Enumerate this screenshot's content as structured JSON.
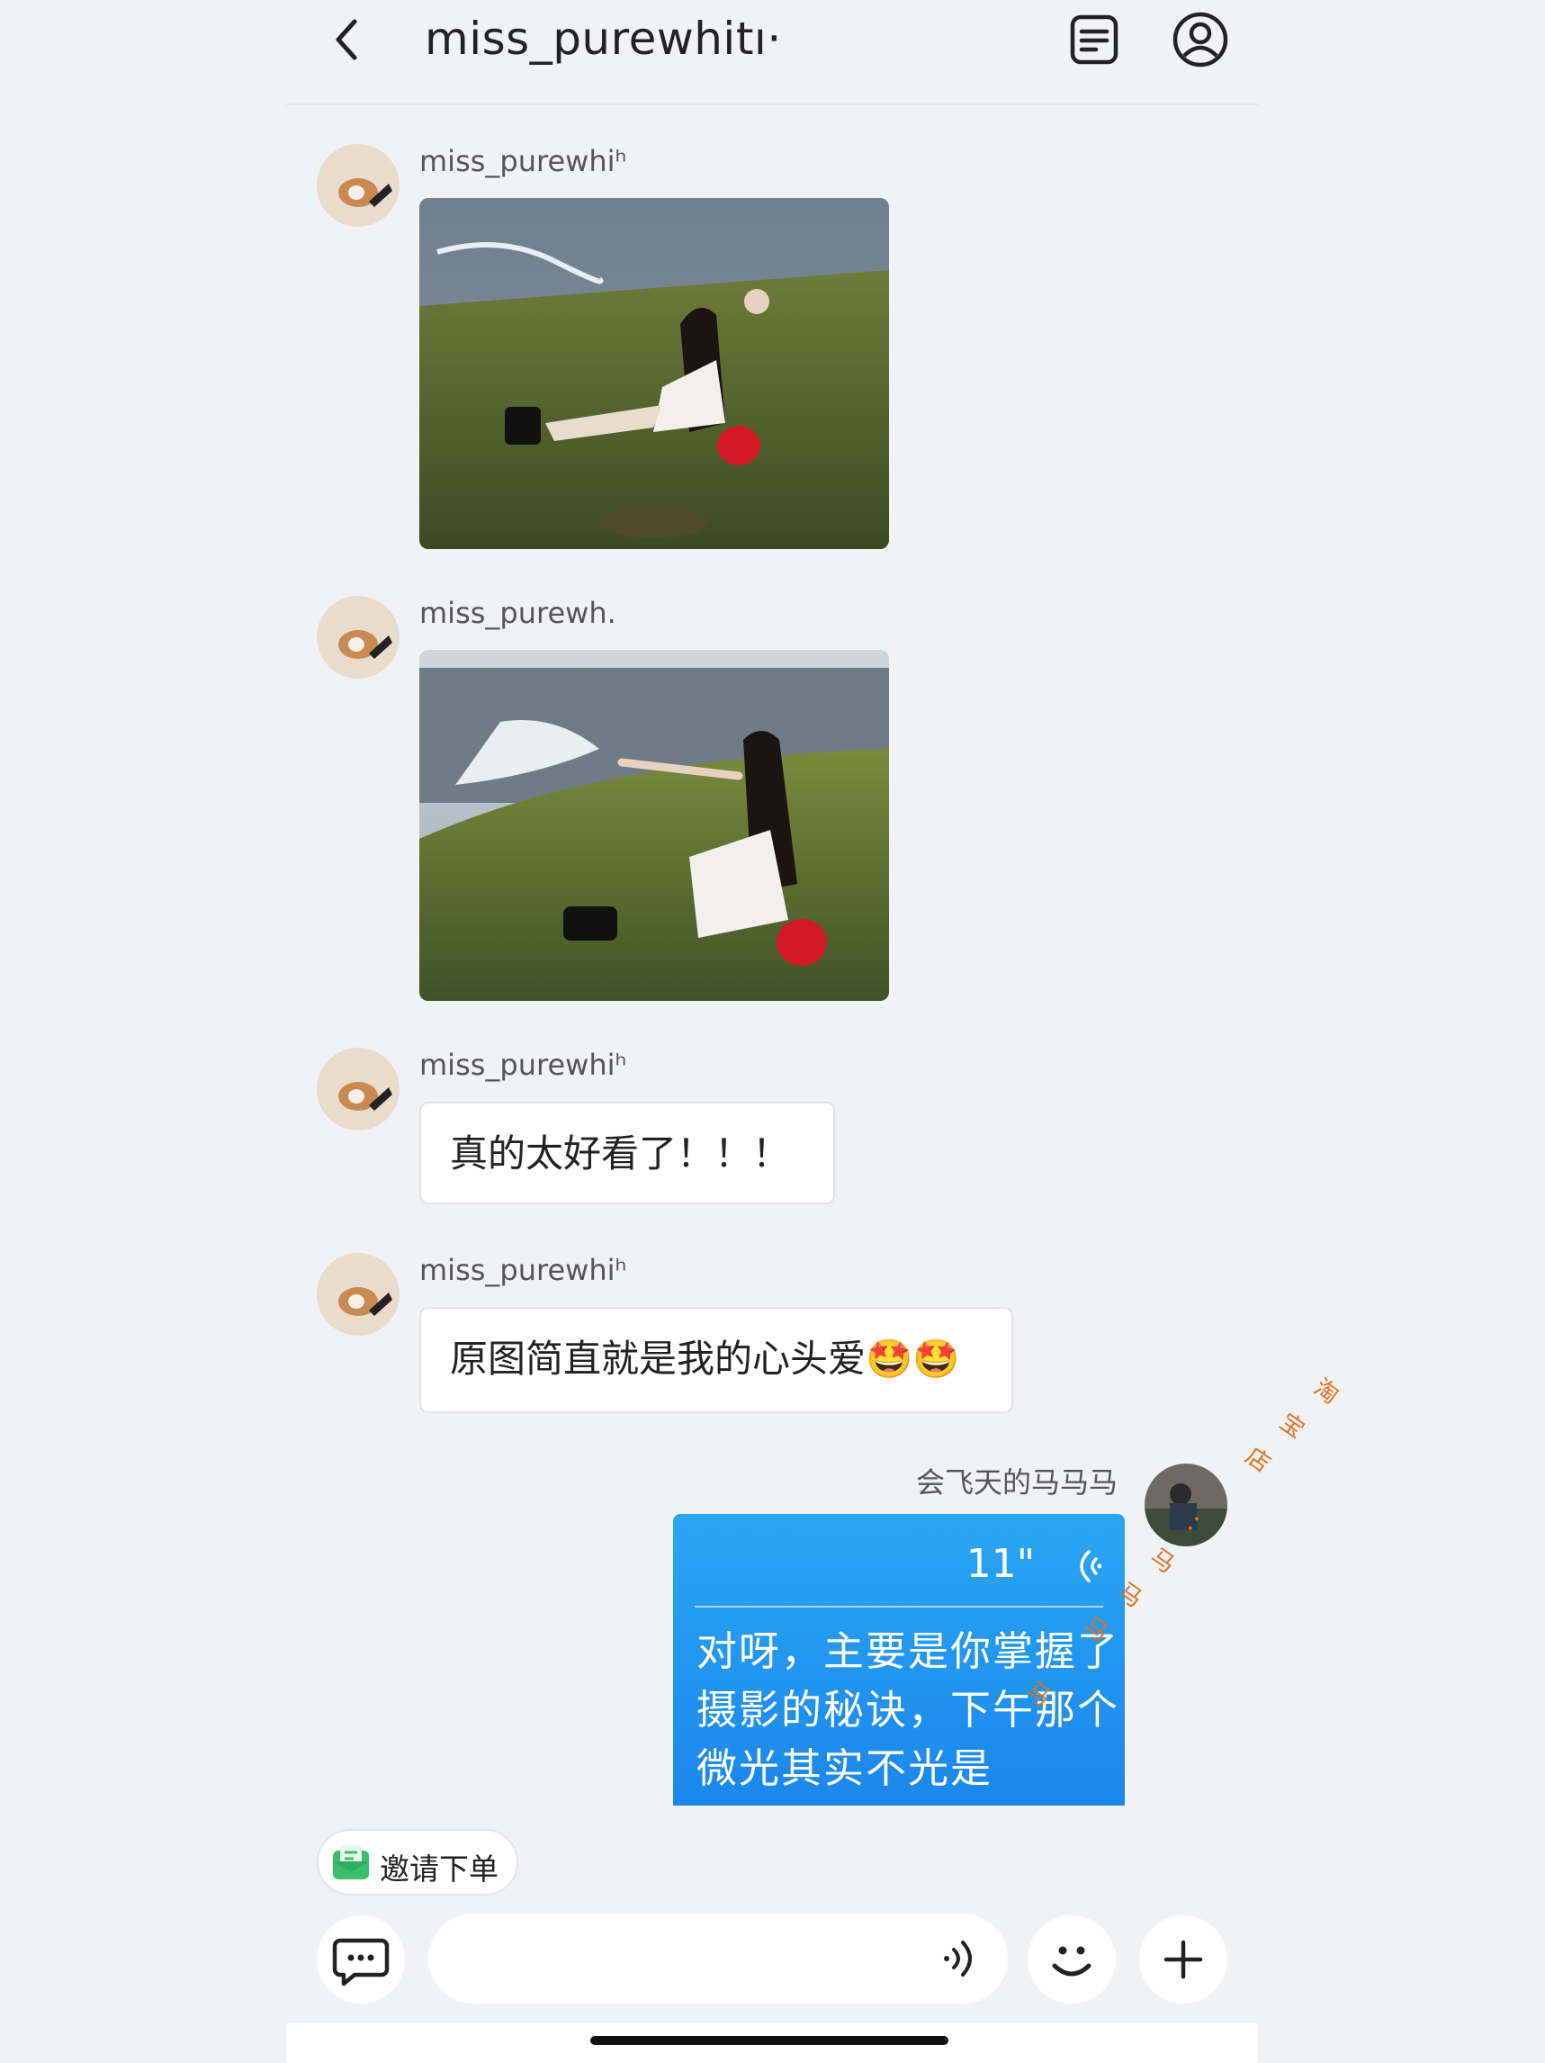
{
  "header": {
    "title": "miss_purewhitı·",
    "back_icon": "chevron-left-icon",
    "order_icon": "document-list-icon",
    "profile_icon": "user-circle-icon"
  },
  "messages": [
    {
      "sender": "miss_purewhiʰ",
      "type": "image"
    },
    {
      "sender": "miss_purewh.",
      "type": "image"
    },
    {
      "sender": "miss_purewhiʰ",
      "type": "text",
      "text": "真的太好看了！！！"
    },
    {
      "sender": "miss_purewhiʰ",
      "type": "text",
      "text": "原图简直就是我的心头爱🤩🤩"
    }
  ],
  "my_message": {
    "sender": "会飞天的马马马",
    "duration": "11\"",
    "transcript": "对呀，主要是你掌握了摄影的秘诀，下午那个微光其实不光是"
  },
  "invite": {
    "label": "邀请下单"
  },
  "composer": {
    "chat_icon": "chat-bubble-icon",
    "voice_icon": "voice-wave-icon",
    "emoji_icon": "smiley-icon",
    "add_icon": "plus-icon"
  },
  "watermark": [
    "淘",
    "宝",
    "店",
    "：",
    "马",
    "马",
    "马",
    "马"
  ],
  "colors": {
    "accent": "#1b86ec",
    "background": "#f1f2f6",
    "watermark": "#e0721c"
  }
}
